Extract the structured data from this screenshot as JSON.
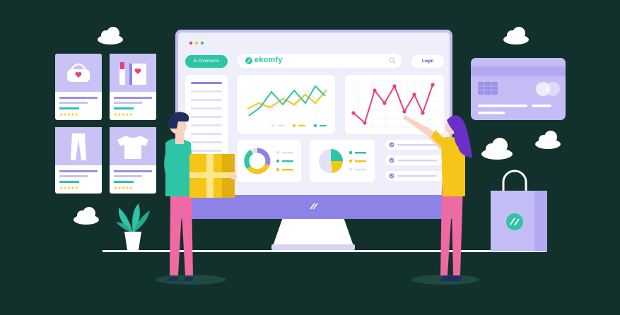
{
  "monitor": {
    "tab_label": "E-Commerce",
    "brand_name": "ekomfy",
    "login_label": "Login"
  },
  "product_cards": [
    {
      "item": "handbag",
      "rating_stars": 5
    },
    {
      "item": "lipstick-and-notebook",
      "rating_stars": 5
    },
    {
      "item": "trousers",
      "rating_stars": 5
    },
    {
      "item": "t-shirt",
      "rating_stars": 5
    }
  ],
  "icons": {
    "search": "search-icon",
    "logo_mark": "ekomfy-logo-icon",
    "check": "check-icon",
    "bag": "shopping-bag-icon",
    "card": "credit-card-icon"
  },
  "colors": {
    "background": "#12302c",
    "accent_purple": "#8e82e6",
    "accent_teal": "#2ec4a6",
    "accent_yellow": "#f5c518",
    "accent_pink": "#ea3f7c"
  }
}
